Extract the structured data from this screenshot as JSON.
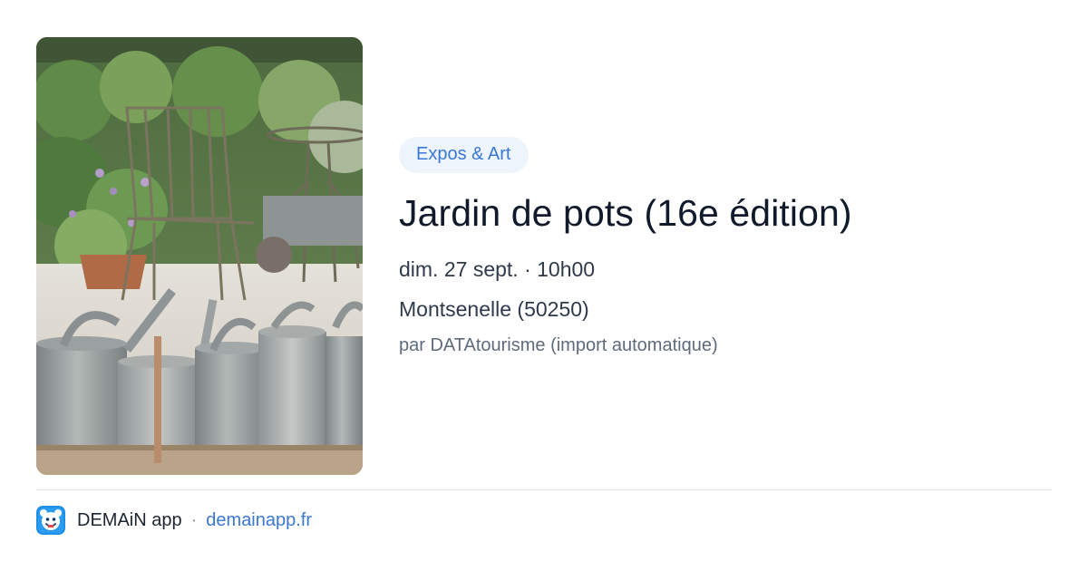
{
  "event": {
    "category": "Expos & Art",
    "title": "Jardin de pots (16e édition)",
    "datetime": "dim. 27 sept. · 10h00",
    "location": "Montsenelle (50250)",
    "source": "par DATAtourisme (import automatique)"
  },
  "footer": {
    "app_name": "DEMAiN app",
    "separator": "·",
    "domain": "demainapp.fr"
  },
  "colors": {
    "accent": "#3a78d4",
    "badge_bg": "#eef4fc",
    "title": "#101a2b",
    "text": "#2e3a4c",
    "muted": "#5f6b7c"
  }
}
